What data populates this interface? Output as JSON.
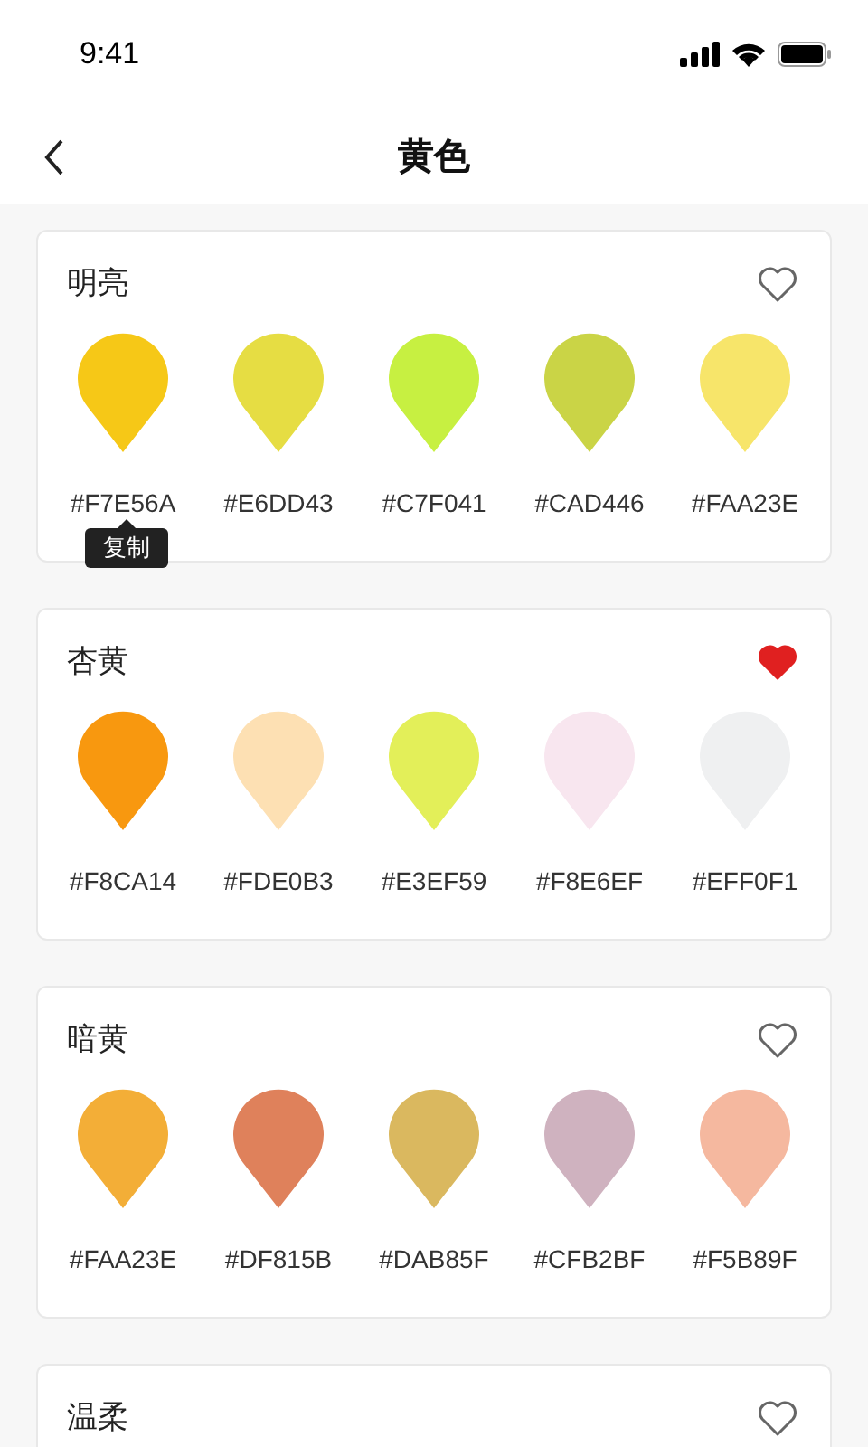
{
  "status_bar": {
    "time": "9:41"
  },
  "nav": {
    "title": "黄色"
  },
  "groups": [
    {
      "name": "明亮",
      "favorite": false,
      "swatches": [
        {
          "code": "#F7E56A",
          "color": "#f6c817",
          "tooltip": "复制"
        },
        {
          "code": "#E6DD43",
          "color": "#e6dd43"
        },
        {
          "code": "#C7F041",
          "color": "#c7f041"
        },
        {
          "code": "#CAD446",
          "color": "#cad446"
        },
        {
          "code": "#FAA23E",
          "color": "#f7e56a"
        }
      ]
    },
    {
      "name": "杏黄",
      "favorite": true,
      "swatches": [
        {
          "code": "#F8CA14",
          "color": "#f8980f"
        },
        {
          "code": "#FDE0B3",
          "color": "#fde0b3"
        },
        {
          "code": "#E3EF59",
          "color": "#e3ef59"
        },
        {
          "code": "#F8E6EF",
          "color": "#f8e6ef"
        },
        {
          "code": "#EFF0F1",
          "color": "#eff0f1"
        }
      ]
    },
    {
      "name": "暗黄",
      "favorite": false,
      "swatches": [
        {
          "code": "#FAA23E",
          "color": "#f3ae37"
        },
        {
          "code": "#DF815B",
          "color": "#df815b"
        },
        {
          "code": "#DAB85F",
          "color": "#dab85f"
        },
        {
          "code": "#CFB2BF",
          "color": "#cfb2bf"
        },
        {
          "code": "#F5B89F",
          "color": "#f5b89f"
        }
      ]
    },
    {
      "name": "温柔",
      "favorite": false
    }
  ]
}
